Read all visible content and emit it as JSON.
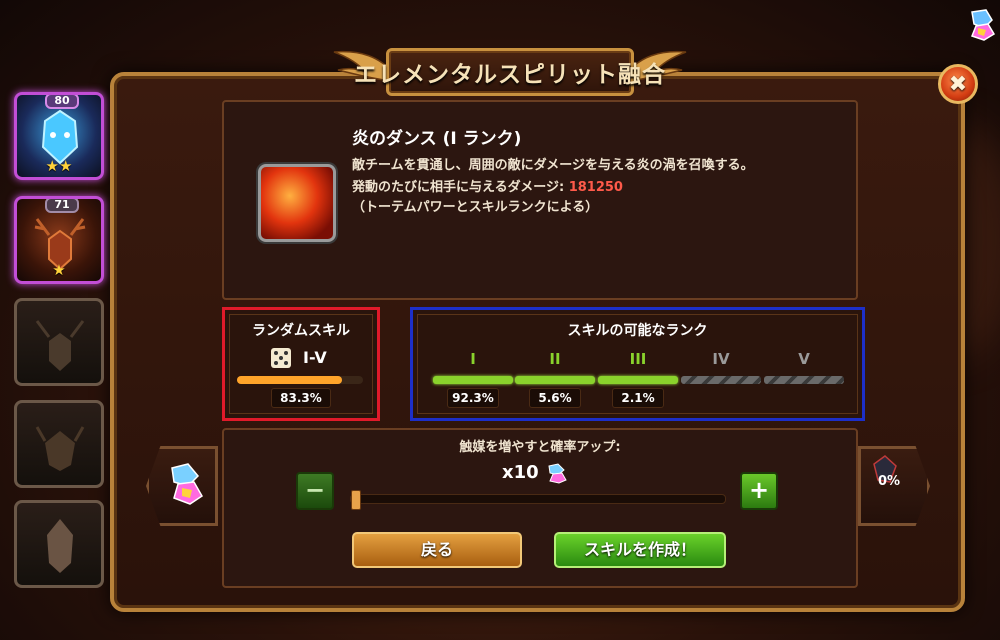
{
  "title": "エレメンタルスピリット融合",
  "close_label": "✖",
  "heroes": [
    {
      "level": "80",
      "stars": "★★"
    },
    {
      "level": "71",
      "stars": "★"
    },
    {
      "level": "",
      "stars": ""
    },
    {
      "level": "",
      "stars": ""
    },
    {
      "level": "",
      "stars": ""
    }
  ],
  "skill": {
    "name": "炎のダンス (I ランク)",
    "desc_line1": "敵チームを貫通し、周囲の敵にダメージを与える炎の渦を召喚する。",
    "desc_line2_prefix": "発動のたびに相手に与えるダメージ: ",
    "damage": "181250",
    "desc_line3": "（トーテムパワーとスキルランクによる）"
  },
  "random_skill": {
    "title": "ランダムスキル",
    "range": "I-V",
    "percent": "83.3%",
    "fill": 0.833
  },
  "ranks": {
    "title": "スキルの可能なランク",
    "items": [
      {
        "label": "I",
        "percent": "92.3%",
        "enabled": true
      },
      {
        "label": "II",
        "percent": "5.6%",
        "enabled": true
      },
      {
        "label": "III",
        "percent": "2.1%",
        "enabled": true
      },
      {
        "label": "IV",
        "percent": "",
        "enabled": false
      },
      {
        "label": "V",
        "percent": "",
        "enabled": false
      }
    ]
  },
  "catalyst": {
    "label": "触媒を増やすと確率アップ:",
    "count": "x10",
    "right_percent": "0%",
    "minus": "−",
    "plus": "+",
    "slider_fill": 0
  },
  "buttons": {
    "back": "戻る",
    "create": "スキルを作成！"
  },
  "colors": {
    "accent_gold": "#c8913f",
    "rank_on": "#8ad22c",
    "highlight_red": "#e01a2a",
    "highlight_blue": "#1d2fc8"
  }
}
